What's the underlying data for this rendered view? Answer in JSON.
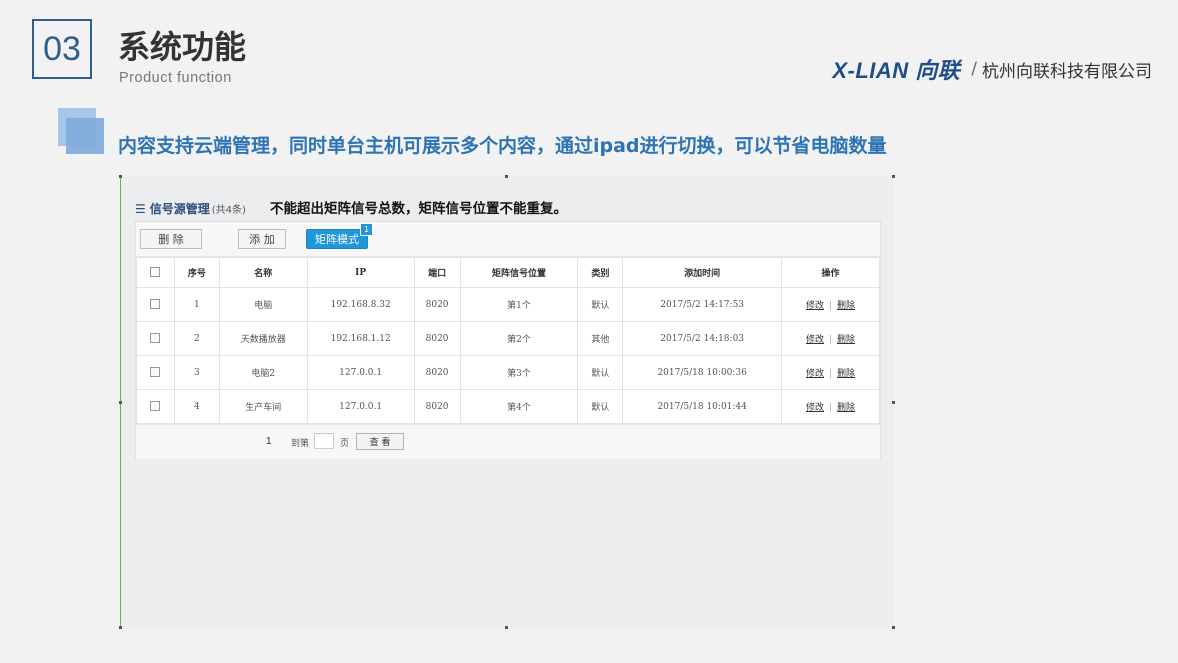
{
  "section": {
    "number": "03",
    "title": "系统功能",
    "subtitle": "Product  function"
  },
  "brand": {
    "logo": "X-LIAN 向联",
    "separator": "/",
    "company": "杭州向联科技有限公司"
  },
  "headline": "内容支持云端管理，同时单台主机可展示多个内容，通过ipad进行切换，可以节省电脑数量",
  "colors": {
    "accent": "#2e74b5",
    "primary_button": "#1f97d9",
    "section_border": "#2f5f8f"
  },
  "screenshot": {
    "panel": {
      "icon": "list-icon",
      "title": "信号源管理",
      "count": "(共4条)",
      "note": "不能超出矩阵信号总数，矩阵信号位置不能重复。"
    },
    "toolbar": {
      "delete_label": "删 除",
      "add_label": "添 加",
      "matrix_label": "矩阵模式",
      "matrix_badge": "1"
    },
    "table": {
      "headers": [
        "序号",
        "名称",
        "IP",
        "端口",
        "矩阵信号位置",
        "类别",
        "添加时间",
        "操作"
      ],
      "rows": [
        {
          "no": "1",
          "name": "电脑",
          "ip": "192.168.8.32",
          "port": "8020",
          "position": "第1个",
          "category": "默认",
          "time": "2017/5/2 14:17:53",
          "edit": "修改",
          "delete": "删除"
        },
        {
          "no": "2",
          "name": "天数播放器",
          "ip": "192.168.1.12",
          "port": "8020",
          "position": "第2个",
          "category": "其他",
          "time": "2017/5/2 14:18:03",
          "edit": "修改",
          "delete": "删除"
        },
        {
          "no": "3",
          "name": "电脑2",
          "ip": "127.0.0.1",
          "port": "8020",
          "position": "第3个",
          "category": "默认",
          "time": "2017/5/18 10:00:36",
          "edit": "修改",
          "delete": "删除"
        },
        {
          "no": "4",
          "name": "生产车间",
          "ip": "127.0.0.1",
          "port": "8020",
          "position": "第4个",
          "category": "默认",
          "time": "2017/5/18 10:01:44",
          "edit": "修改",
          "delete": "删除"
        }
      ],
      "op_separator": "|"
    },
    "pager": {
      "current_page": "1",
      "goto_label": "到第",
      "page_input": "",
      "page_unit": "页",
      "view_label": "查 看"
    }
  }
}
